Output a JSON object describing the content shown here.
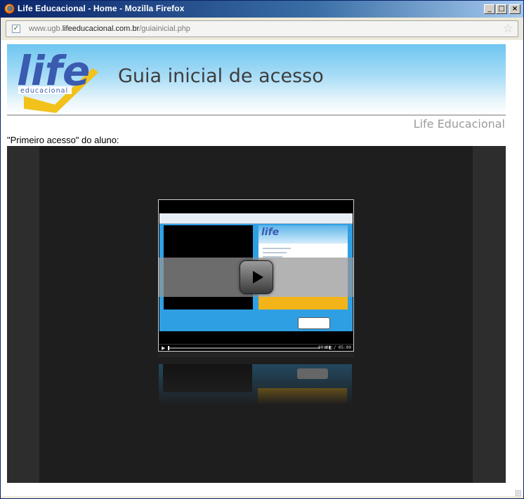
{
  "window": {
    "title": "Life Educacional - Home - Mozilla Firefox",
    "minimize_symbol": "_",
    "maximize_symbol": "□",
    "close_symbol": "×"
  },
  "address_bar": {
    "url_prefix": "www.ugb.",
    "url_domain": "lifeeducacional.com.br",
    "url_path": "/guiainicial.php",
    "check_symbol": "✓",
    "star_symbol": "☆"
  },
  "page": {
    "logo_text": "life",
    "logo_subtext": "educacional",
    "heading": "Guia inicial de acesso",
    "company": "Life Educacional",
    "section_label": "\"Primeiro acesso\" do aluno:"
  },
  "video": {
    "time_display": "00:00 / 05:00",
    "thumb_logo": "life",
    "play_symbol": "▶",
    "control_icons": "⊞ ◧"
  },
  "colors": {
    "title_bar": "#0a246a",
    "banner_top": "#6ec6f0",
    "logo_blue": "#3a5bb0",
    "logo_yellow": "#f2c21b",
    "video_bg": "#1e1e1e"
  },
  "icons": [
    "firefox-icon",
    "check-icon",
    "star-icon",
    "play-icon",
    "resize-grip-icon"
  ]
}
